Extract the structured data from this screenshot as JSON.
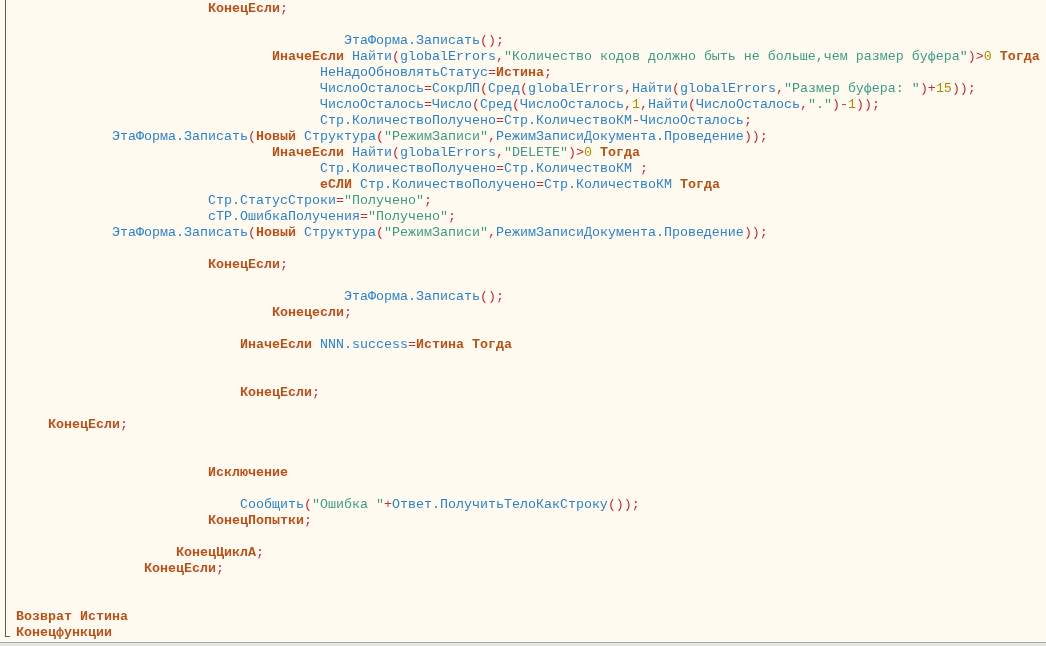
{
  "editor": {
    "lines": [
      {
        "kind": "code",
        "tokens": [
          {
            "kind": "keyword",
            "text": "                        КонецЕсли"
          },
          {
            "kind": "operator",
            "text": ";"
          }
        ]
      },
      {
        "kind": "blank"
      },
      {
        "kind": "code",
        "tokens": [
          {
            "kind": "identifier",
            "text": "                                         ЭтаФорма.Записать"
          },
          {
            "kind": "operator",
            "text": "();"
          }
        ]
      },
      {
        "kind": "code",
        "tokens": [
          {
            "kind": "keyword",
            "text": "                                ИначеЕсли "
          },
          {
            "kind": "identifier",
            "text": "Найти"
          },
          {
            "kind": "operator",
            "text": "("
          },
          {
            "kind": "identifier",
            "text": "globalErrors"
          },
          {
            "kind": "operator",
            "text": ","
          },
          {
            "kind": "string",
            "text": "\"Количество кодов должно быть не больше,чем размер буфера\""
          },
          {
            "kind": "operator",
            "text": ")>"
          },
          {
            "kind": "number",
            "text": "0"
          },
          {
            "kind": "keyword",
            "text": " Тогда"
          }
        ]
      },
      {
        "kind": "code",
        "tokens": [
          {
            "kind": "identifier",
            "text": "                                      НеНадоОбновлятьСтатус"
          },
          {
            "kind": "operator",
            "text": "="
          },
          {
            "kind": "keyword",
            "text": "Истина"
          },
          {
            "kind": "operator",
            "text": ";"
          }
        ]
      },
      {
        "kind": "code",
        "tokens": [
          {
            "kind": "identifier",
            "text": "                                      ЧислоОсталось"
          },
          {
            "kind": "operator",
            "text": "="
          },
          {
            "kind": "identifier",
            "text": "СокрЛП"
          },
          {
            "kind": "operator",
            "text": "("
          },
          {
            "kind": "identifier",
            "text": "Сред"
          },
          {
            "kind": "operator",
            "text": "("
          },
          {
            "kind": "identifier",
            "text": "globalErrors"
          },
          {
            "kind": "operator",
            "text": ","
          },
          {
            "kind": "identifier",
            "text": "Найти"
          },
          {
            "kind": "operator",
            "text": "("
          },
          {
            "kind": "identifier",
            "text": "globalErrors"
          },
          {
            "kind": "operator",
            "text": ","
          },
          {
            "kind": "string",
            "text": "\"Размер буфера: \""
          },
          {
            "kind": "operator",
            "text": ")+"
          },
          {
            "kind": "number",
            "text": "15"
          },
          {
            "kind": "operator",
            "text": "));"
          }
        ]
      },
      {
        "kind": "code",
        "tokens": [
          {
            "kind": "identifier",
            "text": "                                      ЧислоОсталось"
          },
          {
            "kind": "operator",
            "text": "="
          },
          {
            "kind": "identifier",
            "text": "Число"
          },
          {
            "kind": "operator",
            "text": "("
          },
          {
            "kind": "identifier",
            "text": "Сред"
          },
          {
            "kind": "operator",
            "text": "("
          },
          {
            "kind": "identifier",
            "text": "ЧислоОсталось"
          },
          {
            "kind": "operator",
            "text": ","
          },
          {
            "kind": "number",
            "text": "1"
          },
          {
            "kind": "operator",
            "text": ","
          },
          {
            "kind": "identifier",
            "text": "Найти"
          },
          {
            "kind": "operator",
            "text": "("
          },
          {
            "kind": "identifier",
            "text": "ЧислоОсталось"
          },
          {
            "kind": "operator",
            "text": ","
          },
          {
            "kind": "string",
            "text": "\".\""
          },
          {
            "kind": "operator",
            "text": ")-"
          },
          {
            "kind": "number",
            "text": "1"
          },
          {
            "kind": "operator",
            "text": "));"
          }
        ]
      },
      {
        "kind": "code",
        "tokens": [
          {
            "kind": "identifier",
            "text": "                                      Стр.КоличествоПолучено"
          },
          {
            "kind": "operator",
            "text": "="
          },
          {
            "kind": "identifier",
            "text": "Стр.КоличествоКМ"
          },
          {
            "kind": "operator",
            "text": "-"
          },
          {
            "kind": "identifier",
            "text": "ЧислоОсталось"
          },
          {
            "kind": "operator",
            "text": ";"
          }
        ]
      },
      {
        "kind": "code",
        "tokens": [
          {
            "kind": "identifier",
            "text": "            ЭтаФорма.Записать"
          },
          {
            "kind": "operator",
            "text": "("
          },
          {
            "kind": "keyword",
            "text": "Новый "
          },
          {
            "kind": "identifier",
            "text": "Структура"
          },
          {
            "kind": "operator",
            "text": "("
          },
          {
            "kind": "string",
            "text": "\"РежимЗаписи\""
          },
          {
            "kind": "operator",
            "text": ","
          },
          {
            "kind": "identifier",
            "text": "РежимЗаписиДокумента.Проведение"
          },
          {
            "kind": "operator",
            "text": "));"
          }
        ]
      },
      {
        "kind": "code",
        "tokens": [
          {
            "kind": "keyword",
            "text": "                                ИначеЕсли "
          },
          {
            "kind": "identifier",
            "text": "Найти"
          },
          {
            "kind": "operator",
            "text": "("
          },
          {
            "kind": "identifier",
            "text": "globalErrors"
          },
          {
            "kind": "operator",
            "text": ","
          },
          {
            "kind": "string",
            "text": "\"DELETE\""
          },
          {
            "kind": "operator",
            "text": ")>"
          },
          {
            "kind": "number",
            "text": "0"
          },
          {
            "kind": "keyword",
            "text": " Тогда"
          }
        ]
      },
      {
        "kind": "code",
        "tokens": [
          {
            "kind": "identifier",
            "text": "                                      Стр.КоличествоПолучено"
          },
          {
            "kind": "operator",
            "text": "="
          },
          {
            "kind": "identifier",
            "text": "Стр.КоличествоКМ "
          },
          {
            "kind": "operator",
            "text": ";"
          }
        ]
      },
      {
        "kind": "code",
        "tokens": [
          {
            "kind": "keyword",
            "text": "                                      еСЛИ "
          },
          {
            "kind": "identifier",
            "text": "Стр.КоличествоПолучено"
          },
          {
            "kind": "operator",
            "text": "="
          },
          {
            "kind": "identifier",
            "text": "Стр.КоличествоКМ "
          },
          {
            "kind": "keyword",
            "text": "Тогда"
          }
        ]
      },
      {
        "kind": "code",
        "tokens": [
          {
            "kind": "identifier",
            "text": "                        Стр.СтатусСтроки"
          },
          {
            "kind": "operator",
            "text": "="
          },
          {
            "kind": "string",
            "text": "\"Получено\""
          },
          {
            "kind": "operator",
            "text": ";"
          }
        ]
      },
      {
        "kind": "code",
        "tokens": [
          {
            "kind": "identifier",
            "text": "                        сТР.ОшибкаПолучения"
          },
          {
            "kind": "operator",
            "text": "="
          },
          {
            "kind": "string",
            "text": "\"Получено\""
          },
          {
            "kind": "operator",
            "text": ";"
          }
        ]
      },
      {
        "kind": "code",
        "tokens": [
          {
            "kind": "identifier",
            "text": "            ЭтаФорма.Записать"
          },
          {
            "kind": "operator",
            "text": "("
          },
          {
            "kind": "keyword",
            "text": "Новый "
          },
          {
            "kind": "identifier",
            "text": "Структура"
          },
          {
            "kind": "operator",
            "text": "("
          },
          {
            "kind": "string",
            "text": "\"РежимЗаписи\""
          },
          {
            "kind": "operator",
            "text": ","
          },
          {
            "kind": "identifier",
            "text": "РежимЗаписиДокумента.Проведение"
          },
          {
            "kind": "operator",
            "text": "));"
          }
        ]
      },
      {
        "kind": "blank"
      },
      {
        "kind": "code",
        "tokens": [
          {
            "kind": "keyword",
            "text": "                        КонецЕсли"
          },
          {
            "kind": "operator",
            "text": ";"
          }
        ]
      },
      {
        "kind": "blank"
      },
      {
        "kind": "code",
        "tokens": [
          {
            "kind": "identifier",
            "text": "                                         ЭтаФорма.Записать"
          },
          {
            "kind": "operator",
            "text": "();"
          }
        ]
      },
      {
        "kind": "code",
        "tokens": [
          {
            "kind": "keyword",
            "text": "                                Конецесли"
          },
          {
            "kind": "operator",
            "text": ";"
          }
        ]
      },
      {
        "kind": "blank"
      },
      {
        "kind": "code",
        "tokens": [
          {
            "kind": "keyword",
            "text": "                            ИначеЕсли "
          },
          {
            "kind": "identifier",
            "text": "NNN.success"
          },
          {
            "kind": "operator",
            "text": "="
          },
          {
            "kind": "keyword",
            "text": "Истина Тогда"
          }
        ]
      },
      {
        "kind": "blank"
      },
      {
        "kind": "blank"
      },
      {
        "kind": "code",
        "tokens": [
          {
            "kind": "keyword",
            "text": "                            КонецЕсли"
          },
          {
            "kind": "operator",
            "text": ";"
          }
        ]
      },
      {
        "kind": "blank"
      },
      {
        "kind": "code",
        "tokens": [
          {
            "kind": "keyword",
            "text": "    КонецЕсли"
          },
          {
            "kind": "operator",
            "text": ";"
          }
        ]
      },
      {
        "kind": "blank"
      },
      {
        "kind": "blank"
      },
      {
        "kind": "code",
        "tokens": [
          {
            "kind": "keyword",
            "text": "                        Исключение"
          }
        ]
      },
      {
        "kind": "blank"
      },
      {
        "kind": "code",
        "tokens": [
          {
            "kind": "identifier",
            "text": "                            Сообщить"
          },
          {
            "kind": "operator",
            "text": "("
          },
          {
            "kind": "string",
            "text": "\"Ошибка \""
          },
          {
            "kind": "operator",
            "text": "+"
          },
          {
            "kind": "identifier",
            "text": "Ответ.ПолучитьТелоКакСтроку"
          },
          {
            "kind": "operator",
            "text": "());"
          }
        ]
      },
      {
        "kind": "code",
        "tokens": [
          {
            "kind": "keyword",
            "text": "                        КонецПопытки"
          },
          {
            "kind": "operator",
            "text": ";"
          }
        ]
      },
      {
        "kind": "blank"
      },
      {
        "kind": "code",
        "tokens": [
          {
            "kind": "keyword",
            "text": "                    КонецЦиклА"
          },
          {
            "kind": "operator",
            "text": ";"
          }
        ]
      },
      {
        "kind": "code",
        "tokens": [
          {
            "kind": "keyword",
            "text": "                КонецЕсли"
          },
          {
            "kind": "operator",
            "text": ";"
          }
        ]
      },
      {
        "kind": "blank"
      },
      {
        "kind": "blank"
      },
      {
        "kind": "code",
        "tokens": [
          {
            "kind": "keyword",
            "text": "Возврат Истина"
          }
        ]
      },
      {
        "kind": "code",
        "tokens": [
          {
            "kind": "keyword",
            "text": "Конецфункции"
          }
        ]
      }
    ]
  }
}
